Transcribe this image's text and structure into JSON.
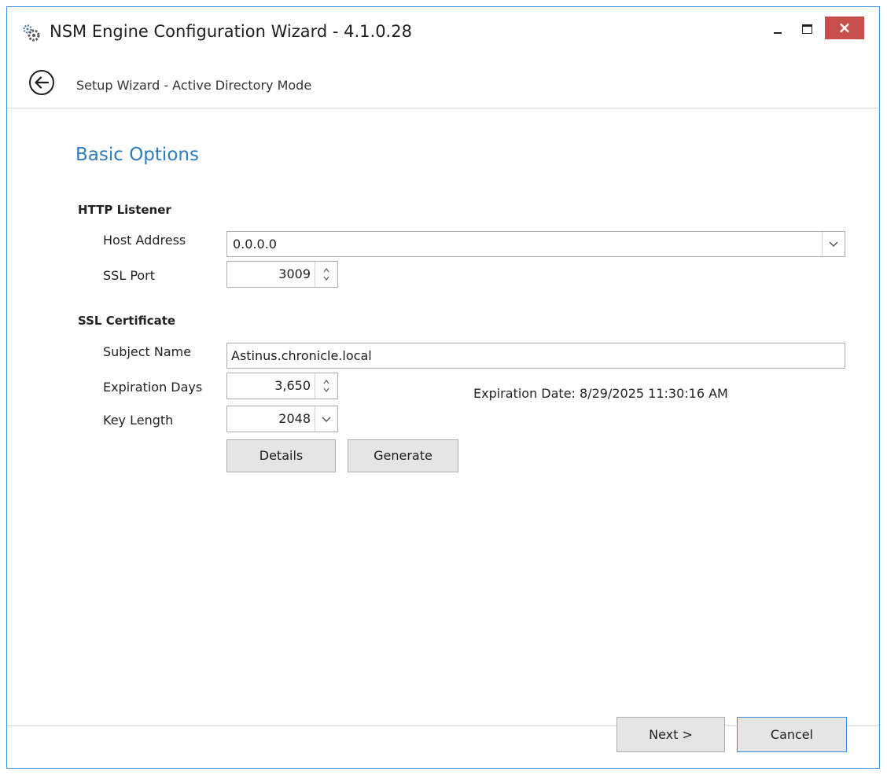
{
  "window": {
    "title": "NSM Engine Configuration Wizard - 4.1.0.28",
    "close_glyph": "×"
  },
  "wizard": {
    "header": "Setup Wizard - Active Directory Mode"
  },
  "page": {
    "section_title": "Basic Options",
    "http_listener": {
      "group_label": "HTTP Listener",
      "host_address_label": "Host Address",
      "host_address_value": "0.0.0.0",
      "ssl_port_label": "SSL Port",
      "ssl_port_value": "3009"
    },
    "ssl_certificate": {
      "group_label": "SSL Certificate",
      "subject_name_label": "Subject Name",
      "subject_name_value": "Astinus.chronicle.local",
      "expiration_days_label": "Expiration Days",
      "expiration_days_value": "3,650",
      "expiration_date_text": "Expiration Date: 8/29/2025 11:30:16 AM",
      "key_length_label": "Key Length",
      "key_length_value": "2048",
      "details_label": "Details",
      "generate_label": "Generate"
    }
  },
  "footer": {
    "next_label": "Next >",
    "cancel_label": "Cancel"
  },
  "colors": {
    "accent": "#2e7cc4",
    "close_button": "#c7504f",
    "window_border": "#4a90d8"
  },
  "icons": [
    "gears-icon",
    "minimize-icon",
    "maximize-icon",
    "close-icon",
    "back-arrow-icon",
    "chevron-down-icon",
    "spin-up-icon",
    "spin-down-icon"
  ]
}
